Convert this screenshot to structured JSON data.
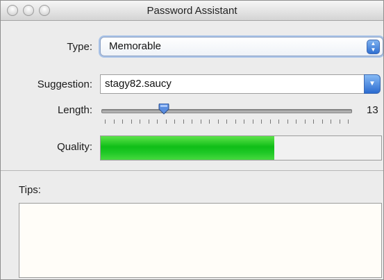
{
  "window": {
    "title": "Password Assistant"
  },
  "type": {
    "label": "Type:",
    "value": "Memorable"
  },
  "suggestion": {
    "label": "Suggestion:",
    "value": "stagy82.saucy"
  },
  "length": {
    "label": "Length:",
    "value": "13",
    "slider_fraction": 0.25,
    "tick_count": 29
  },
  "quality": {
    "label": "Quality:",
    "fraction": 0.62
  },
  "tips": {
    "label": "Tips:",
    "text": ""
  },
  "colors": {
    "quality_fill": "#1cc31f",
    "slider_knob": "#5b8ee0"
  }
}
